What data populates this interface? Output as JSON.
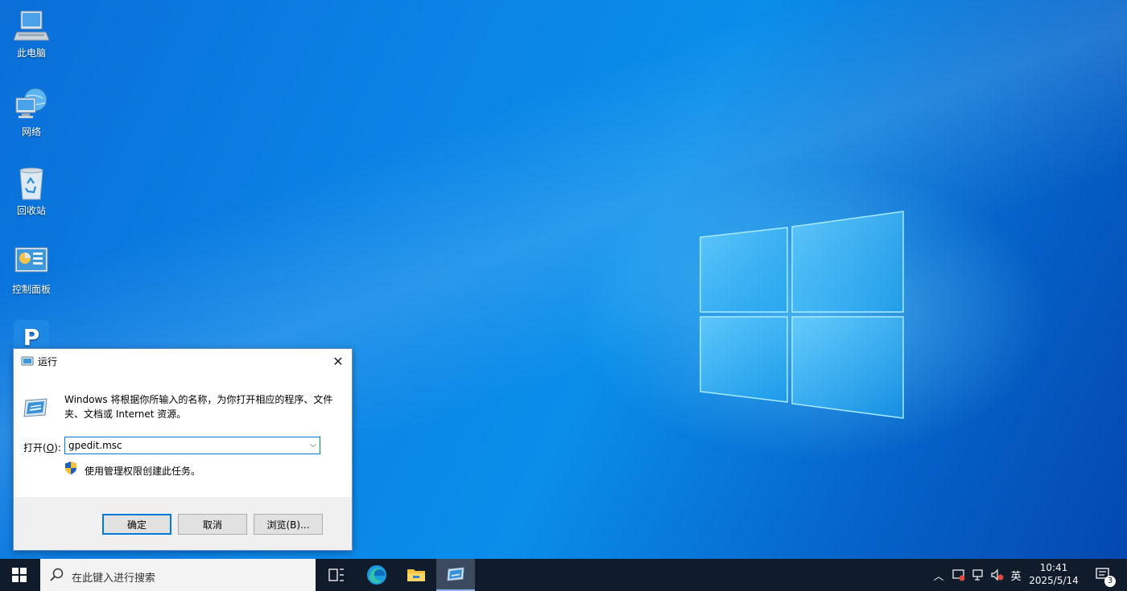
{
  "desktop": {
    "icons": [
      {
        "label": "此电脑",
        "icon": "this-pc-icon"
      },
      {
        "label": "网络",
        "icon": "network-icon"
      },
      {
        "label": "回收站",
        "icon": "recycle-bin-icon"
      },
      {
        "label": "控制面板",
        "icon": "control-panel-icon"
      },
      {
        "label": "P",
        "icon": "p-app-icon"
      }
    ]
  },
  "run_dialog": {
    "title": "运行",
    "description": "Windows 将根据你所输入的名称，为你打开相应的程序、文件夹、文档或 Internet 资源。",
    "open_label": "打开(",
    "open_label_key": "O",
    "open_label_end": "):",
    "input_value": "gpedit.msc",
    "admin_text": "使用管理权限创建此任务。",
    "buttons": {
      "ok": "确定",
      "cancel": "取消",
      "browse": "浏览(B)..."
    }
  },
  "taskbar": {
    "search_placeholder": "在此键入进行搜索",
    "ime": "英",
    "time": "10:41",
    "date": "2025/5/14",
    "notification_count": "3"
  },
  "colors": {
    "accent": "#0078d7",
    "taskbar": "#101b2c"
  }
}
